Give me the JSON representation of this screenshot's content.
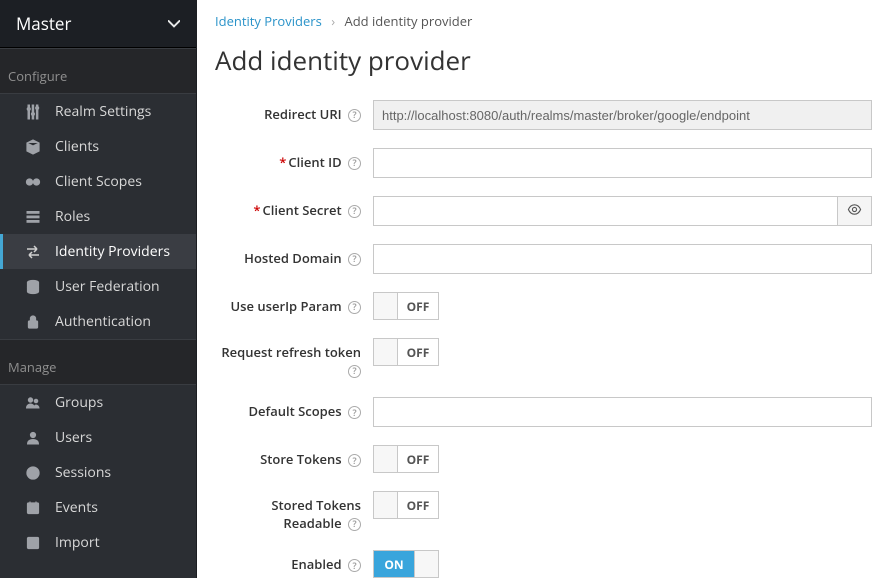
{
  "realm": {
    "name": "Master"
  },
  "sidebar": {
    "sections": {
      "configure": {
        "title": "Configure",
        "items": [
          {
            "label": "Realm Settings"
          },
          {
            "label": "Clients"
          },
          {
            "label": "Client Scopes"
          },
          {
            "label": "Roles"
          },
          {
            "label": "Identity Providers"
          },
          {
            "label": "User Federation"
          },
          {
            "label": "Authentication"
          }
        ]
      },
      "manage": {
        "title": "Manage",
        "items": [
          {
            "label": "Groups"
          },
          {
            "label": "Users"
          },
          {
            "label": "Sessions"
          },
          {
            "label": "Events"
          },
          {
            "label": "Import"
          }
        ]
      }
    }
  },
  "breadcrumb": {
    "parent": "Identity Providers",
    "current": "Add identity provider"
  },
  "page": {
    "title": "Add identity provider"
  },
  "form": {
    "redirect_uri": {
      "label": "Redirect URI",
      "value": "http://localhost:8080/auth/realms/master/broker/google/endpoint"
    },
    "client_id": {
      "label": "Client ID",
      "value": ""
    },
    "client_secret": {
      "label": "Client Secret",
      "value": ""
    },
    "hosted_domain": {
      "label": "Hosted Domain",
      "value": ""
    },
    "use_userip": {
      "label": "Use userIp Param",
      "state": "OFF"
    },
    "request_refresh": {
      "label": "Request refresh token",
      "state": "OFF"
    },
    "default_scopes": {
      "label": "Default Scopes",
      "value": ""
    },
    "store_tokens": {
      "label": "Store Tokens",
      "state": "OFF"
    },
    "stored_tokens_readable": {
      "label": "Stored Tokens Readable",
      "state": "OFF"
    },
    "enabled": {
      "label": "Enabled",
      "state": "ON"
    }
  },
  "toggle_labels": {
    "on": "ON",
    "off": "OFF"
  }
}
